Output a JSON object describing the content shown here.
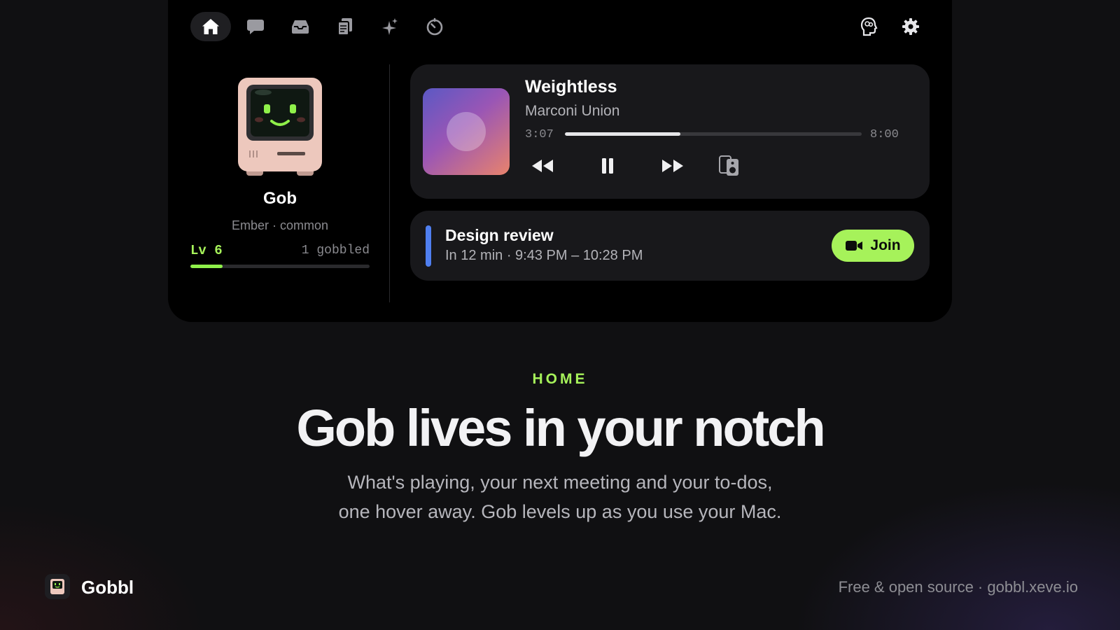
{
  "nav": {
    "items": [
      {
        "name": "home",
        "icon": "home-icon",
        "active": true
      },
      {
        "name": "chat",
        "icon": "chat-bubble-icon",
        "active": false
      },
      {
        "name": "inbox",
        "icon": "tray-icon",
        "active": false
      },
      {
        "name": "files",
        "icon": "documents-icon",
        "active": false
      },
      {
        "name": "sparkles",
        "icon": "sparkles-icon",
        "active": false
      },
      {
        "name": "timer",
        "icon": "timer-icon",
        "active": false
      }
    ],
    "right_items": [
      {
        "name": "brain",
        "icon": "brain-head-icon"
      },
      {
        "name": "settings",
        "icon": "gear-icon"
      }
    ]
  },
  "pet": {
    "name": "Gob",
    "subtitle": "Ember · common",
    "level": "Lv 6",
    "gobbled": "1 gobbled",
    "xp_progress": 0.18
  },
  "now_playing": {
    "title": "Weightless",
    "artist": "Marconi Union",
    "elapsed": "3:07",
    "duration": "8:00",
    "progress": 0.39,
    "controls": [
      "rewind-icon",
      "pause-icon",
      "fast-forward-icon",
      "speakers-icon"
    ]
  },
  "meeting": {
    "title": "Design review",
    "time": "In 12 min · 9:43 PM – 10:28 PM",
    "join_label": "Join",
    "join_icon": "video-camera-icon"
  },
  "hero": {
    "eyebrow": "HOME",
    "headline": "Gob lives in your notch",
    "subtext_line1": "What's playing, your next meeting and your to-dos,",
    "subtext_line2": "one hover away. Gob levels up as you use your Mac."
  },
  "footer": {
    "brand": "Gobbl",
    "link_text": "Free & open source · gobbl.xeve.io"
  },
  "colors": {
    "accent": "#a6f25a",
    "meeting_bar": "#4f7ff0",
    "card": "#18181b",
    "panel": "#000000"
  }
}
